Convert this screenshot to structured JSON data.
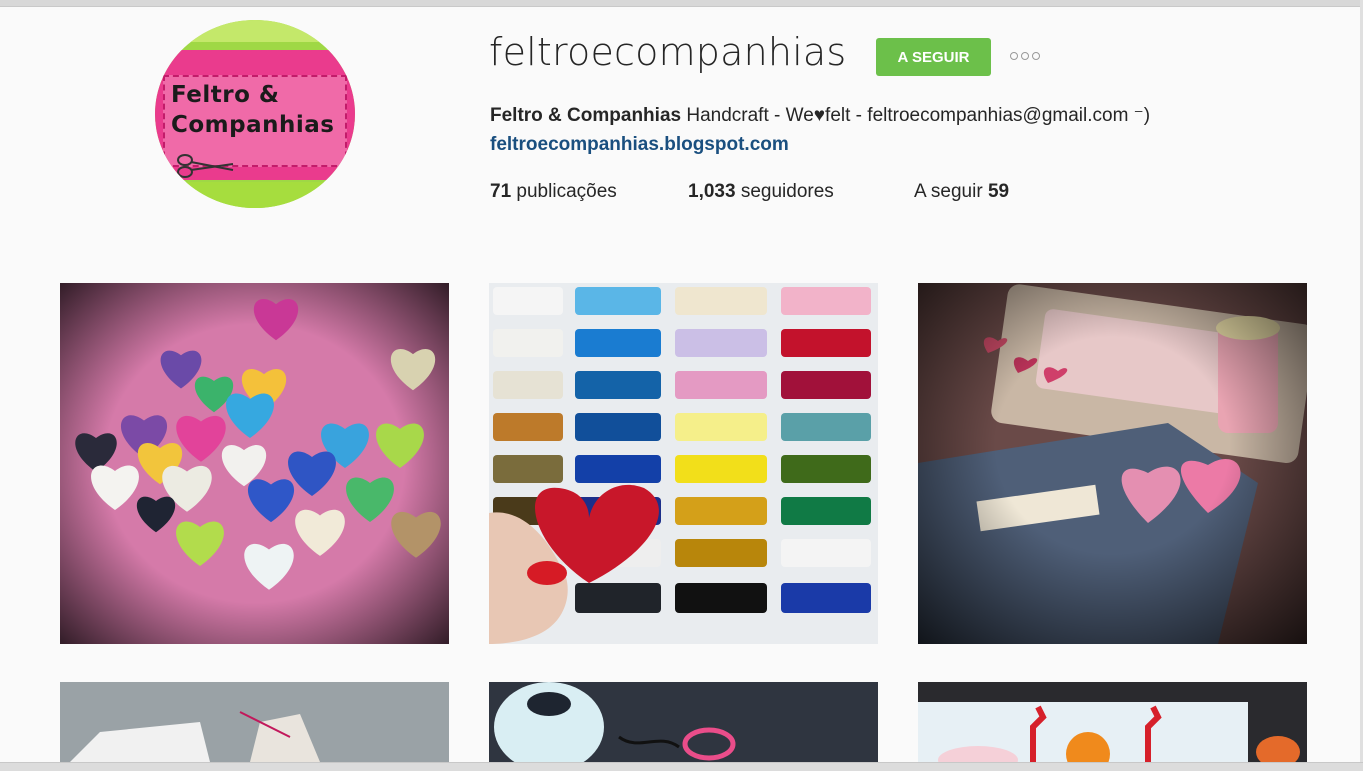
{
  "profile": {
    "username": "feltroecompanhias",
    "follow_label": "A SEGUIR",
    "bio_name": "Feltro & Companhias",
    "bio_text": " Handcraft - We♥felt - feltroecompanhias@gmail.com ⁻)",
    "website": "feltroecompanhias.blogspot.com",
    "avatar_logo_line1": "Feltro &",
    "avatar_logo_line2": "Companhias"
  },
  "stats": {
    "posts_count": "71",
    "posts_label": " publicações",
    "followers_count": "1,033",
    "followers_label": " seguidores",
    "following_label": "A seguir ",
    "following_count": "59"
  },
  "icons": {
    "more": "more-options-icon"
  },
  "colors": {
    "follow_button": "#6cc04a",
    "link": "#1a4f7f",
    "text": "#262626"
  },
  "posts": [
    {
      "description": "colorful heart buttons on pink felt"
    },
    {
      "description": "rows of colored thread spools with red felt heart"
    },
    {
      "description": "felt crafts with pink thread spool and hearts"
    },
    {
      "description": "white fabric with stitched edge"
    },
    {
      "description": "crochet thread and tools"
    },
    {
      "description": "felt pieces with red ric-rac and sun"
    }
  ]
}
